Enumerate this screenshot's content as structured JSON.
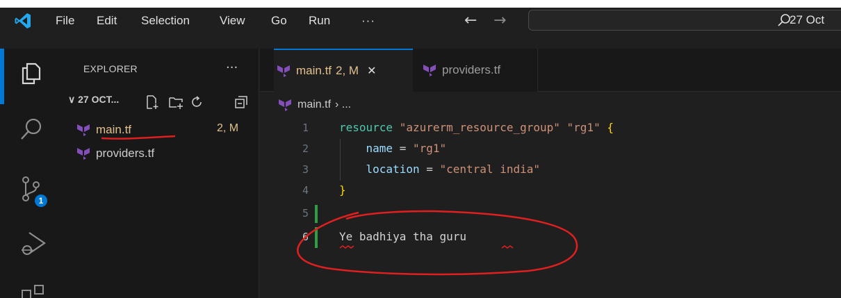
{
  "menu": {
    "items": [
      "File",
      "Edit",
      "Selection",
      "View",
      "Go",
      "Run"
    ],
    "more": "···"
  },
  "search": {
    "text": "27 Oct"
  },
  "activity": {
    "scm_badge": "1"
  },
  "explorer": {
    "title": "EXPLORER",
    "more": "···",
    "folder": "∨ 27 OCT...",
    "files": [
      {
        "name": "main.tf",
        "status": "2, M"
      },
      {
        "name": "providers.tf"
      }
    ]
  },
  "tabs": [
    {
      "label": "main.tf",
      "status": "2, M",
      "close": "✕"
    },
    {
      "label": "providers.tf"
    }
  ],
  "breadcrumb": {
    "file": "main.tf",
    "rest": "› ..."
  },
  "code": {
    "line_numbers": [
      "1",
      "2",
      "3",
      "4",
      "5",
      "6"
    ],
    "l1_kw": "resource",
    "l1_s1": "\"azurerm_resource_group\"",
    "l1_s2": "\"rg1\"",
    "l1_brace": "{",
    "l2_attr": "name",
    "l2_eq": " = ",
    "l2_val": "\"rg1\"",
    "l3_attr": "location",
    "l3_eq": " = ",
    "l3_val": "\"central india\"",
    "l4_brace": "}",
    "l6_text": "Ye badhiya tha guru"
  },
  "colors": {
    "accent": "#0078d4",
    "annotation": "#e02020",
    "terraform": "#844fba",
    "modified": "#e2c08d",
    "added": "#2ea043"
  }
}
